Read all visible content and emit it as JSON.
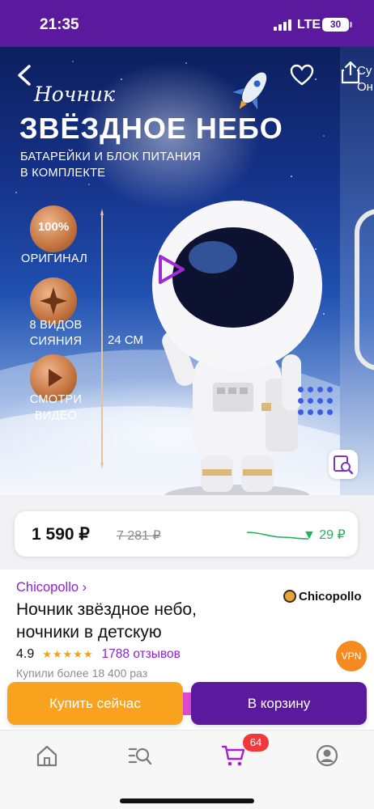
{
  "status_bar": {
    "time": "21:35",
    "network": "LTE",
    "battery": "30"
  },
  "hero": {
    "script_title": "Ночник",
    "title": "ЗВЁЗДНОЕ НЕБО",
    "subtitle_line1": "БАТАРЕЙКИ И БЛОК ПИТАНИЯ",
    "subtitle_line2": "В КОМПЛЕКТЕ",
    "badges": [
      {
        "icon": "laurel-100-badge-icon",
        "badge_text": "100%",
        "label_line1": "ОРИГИНАЛ",
        "label_line2": ""
      },
      {
        "icon": "sparkle-badge-icon",
        "label_line1": "8 ВИДОВ",
        "label_line2": "СИЯНИЯ"
      },
      {
        "icon": "play-badge-icon",
        "label_line1": "СМОТРИ",
        "label_line2": "ВИДЕО"
      }
    ],
    "height_label": "24 СМ",
    "share_label_line1": "Су",
    "share_label_line2": "Он"
  },
  "price": {
    "current": "1 590 ₽",
    "old": "7 281 ₽",
    "drop": "▼ 29 ₽",
    "drop_color": "#1fb35a"
  },
  "product": {
    "brand_link": "Chicopollo ›",
    "brand_logo_text": "Chicopollo",
    "title_line1": "Ночник звёздное небо,",
    "title_line2": "ночники в детскую",
    "rating": "4.9",
    "stars": "★★★★★",
    "reviews": "1788 отзывов",
    "bought": "Купили более 18 400 раз",
    "vpn_badge": "VPN"
  },
  "actions": {
    "buy_now": "Купить сейчас",
    "add_to_cart": "В корзину"
  },
  "bottom_nav": {
    "items": [
      "home-icon",
      "catalog-search-icon",
      "cart-icon",
      "profile-icon"
    ],
    "cart_count": "64"
  },
  "colors": {
    "brand_purple": "#5b1a9e",
    "accent_orange": "#f8a21d",
    "link_purple": "#8b22d6",
    "badge_red": "#f1383d"
  }
}
